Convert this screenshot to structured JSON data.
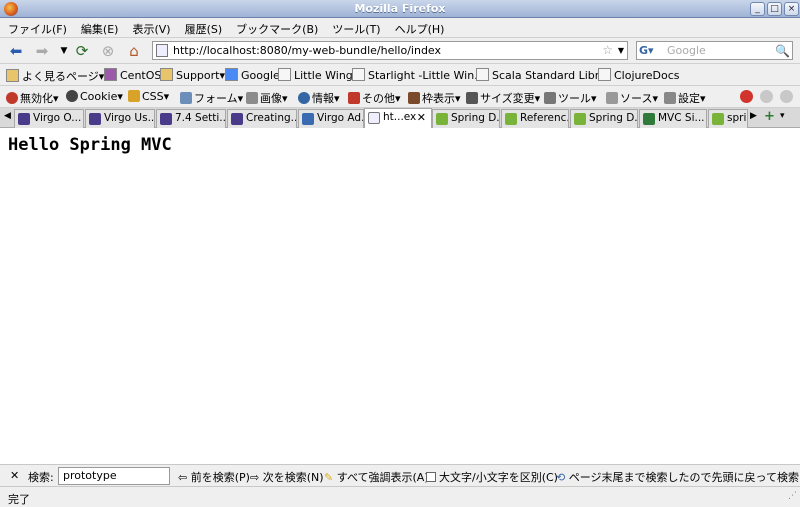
{
  "window": {
    "title": "Mozilla Firefox"
  },
  "menu": [
    "ファイル(F)",
    "編集(E)",
    "表示(V)",
    "履歴(S)",
    "ブックマーク(B)",
    "ツール(T)",
    "ヘルプ(H)"
  ],
  "nav": {
    "url": "http://localhost:8080/my-web-bundle/hello/index",
    "search_placeholder": "Google"
  },
  "bookmarks": [
    "よく見るページ",
    "CentOS",
    "Support",
    "Google",
    "Little Wings",
    "Starlight -Little Win...",
    "Scala Standard Libr...",
    "ClojureDocs"
  ],
  "devtools": [
    "無効化",
    "Cookie",
    "CSS",
    "フォーム",
    "画像",
    "情報",
    "その他",
    "枠表示",
    "サイズ変更",
    "ツール",
    "ソース",
    "設定"
  ],
  "tabs": [
    "Virgo O...",
    "Virgo Us...",
    "7.4 Setti...",
    "Creating...",
    "Virgo Ad...",
    "ht...ex",
    "Spring D...",
    "Referenc...",
    "Spring D...",
    "MVC Si...",
    "sprin"
  ],
  "page": {
    "heading": "Hello Spring MVC"
  },
  "findbar": {
    "label": "検索:",
    "value": "prototype",
    "prev": "前を検索(P)",
    "next": "次を検索(N)",
    "highlight": "すべて強調表示(A)",
    "matchcase": "大文字/小文字を区別(C)",
    "message": "ページ末尾まで検索したので先頭に戻って検索しまし"
  },
  "status": {
    "text": "完了"
  }
}
